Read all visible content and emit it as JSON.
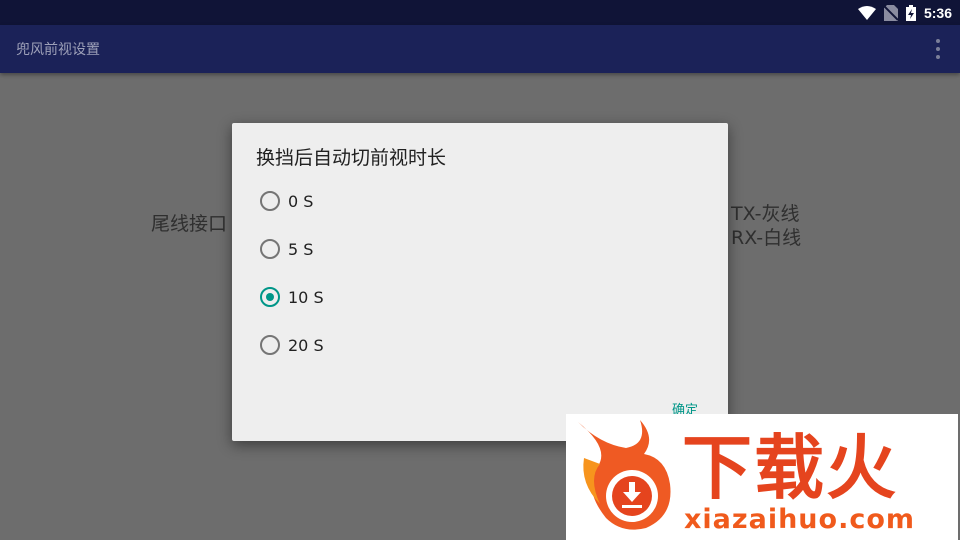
{
  "status_bar": {
    "time": "5:36",
    "icons": [
      "wifi-icon",
      "no-sim-icon",
      "battery-charging-icon"
    ]
  },
  "app_bar": {
    "title": "兜风前视设置",
    "menu_icon": "overflow-menu-icon"
  },
  "background": {
    "left_text": "尾线接口",
    "right_line1": "TX-灰线",
    "right_line2": "RX-白线"
  },
  "dialog": {
    "title": "换挡后自动切前视时长",
    "options": [
      {
        "label": "0 S",
        "checked": false
      },
      {
        "label": "5 S",
        "checked": false
      },
      {
        "label": "10 S",
        "checked": true
      },
      {
        "label": "20 S",
        "checked": false
      }
    ],
    "confirm_label": "确定"
  },
  "watermark": {
    "brand": "下载火",
    "url": "xiazaihuo.com"
  },
  "colors": {
    "status_bar": "#101437",
    "app_bar": "#1b2258",
    "accent": "#009688",
    "scrim": "#6d6d6d",
    "brand_orange": "#e5441e"
  }
}
